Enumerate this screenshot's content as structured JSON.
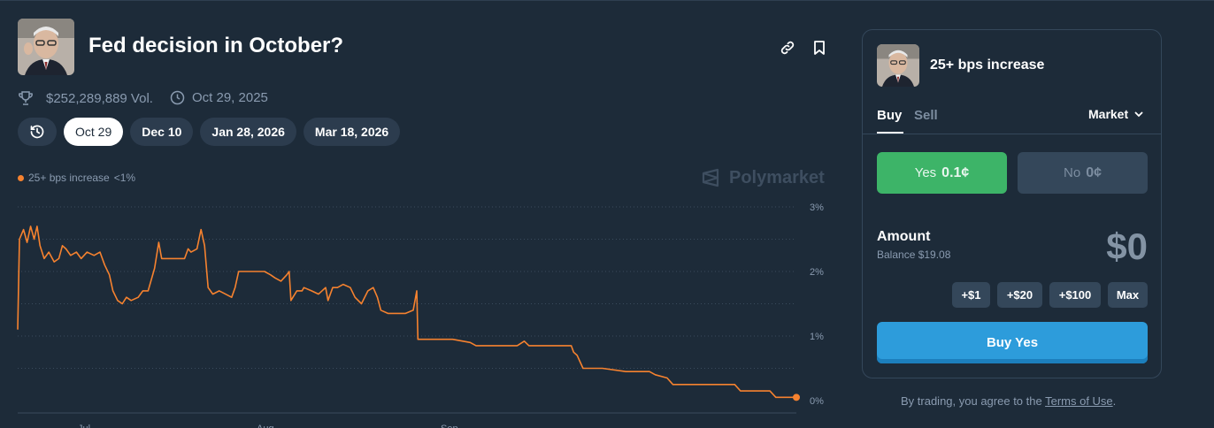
{
  "market": {
    "title": "Fed decision in October?",
    "volume": "$252,289,889 Vol.",
    "date": "Oct 29, 2025",
    "avatar_icon": "powell-portrait",
    "date_tabs": [
      "Oct 29",
      "Dec 10",
      "Jan 28, 2026",
      "Mar 18, 2026"
    ],
    "active_tab": "Oct 29",
    "watermark": "Polymarket"
  },
  "chart_data": {
    "type": "line",
    "legend": [
      {
        "name": "25+ bps increase",
        "value": "<1%",
        "color": "#f6822f"
      }
    ],
    "ylim": [
      0,
      3
    ],
    "y_ticks": [
      "3%",
      "2%",
      "1%",
      "0%"
    ],
    "x_ticks": [
      "Jul",
      "Aug",
      "Sep"
    ],
    "grid": true,
    "series": [
      {
        "name": "25+ bps increase",
        "color": "#f6822f",
        "points": [
          [
            0,
            1.1
          ],
          [
            0.3,
            2.5
          ],
          [
            1,
            2.65
          ],
          [
            1.6,
            2.45
          ],
          [
            2.2,
            2.7
          ],
          [
            2.8,
            2.5
          ],
          [
            3.3,
            2.7
          ],
          [
            3.8,
            2.4
          ],
          [
            4.5,
            2.2
          ],
          [
            5.3,
            2.3
          ],
          [
            6.2,
            2.15
          ],
          [
            7,
            2.2
          ],
          [
            7.6,
            2.4
          ],
          [
            8.2,
            2.35
          ],
          [
            9,
            2.25
          ],
          [
            10,
            2.3
          ],
          [
            10.8,
            2.2
          ],
          [
            11.8,
            2.3
          ],
          [
            13,
            2.25
          ],
          [
            14,
            2.3
          ],
          [
            14.8,
            2.1
          ],
          [
            15.6,
            1.95
          ],
          [
            16.2,
            1.7
          ],
          [
            17,
            1.55
          ],
          [
            17.8,
            1.5
          ],
          [
            18.5,
            1.6
          ],
          [
            19.3,
            1.55
          ],
          [
            20.5,
            1.6
          ],
          [
            21.3,
            1.7
          ],
          [
            22.2,
            1.7
          ],
          [
            23.3,
            2.05
          ],
          [
            24,
            2.45
          ],
          [
            24.5,
            2.2
          ],
          [
            26.2,
            2.2
          ],
          [
            28.4,
            2.2
          ],
          [
            29,
            2.35
          ],
          [
            29.5,
            2.3
          ],
          [
            30.5,
            2.35
          ],
          [
            31.2,
            2.65
          ],
          [
            31.8,
            2.4
          ],
          [
            32.4,
            1.75
          ],
          [
            33.2,
            1.65
          ],
          [
            34.3,
            1.7
          ],
          [
            36.4,
            1.6
          ],
          [
            37,
            1.75
          ],
          [
            37.6,
            2.0
          ],
          [
            42,
            2.0
          ],
          [
            43,
            1.95
          ],
          [
            43.8,
            1.9
          ],
          [
            44.8,
            1.85
          ],
          [
            45.8,
            1.95
          ],
          [
            46.2,
            2.0
          ],
          [
            46.5,
            1.55
          ],
          [
            47.5,
            1.7
          ],
          [
            48.4,
            1.7
          ],
          [
            48.7,
            1.75
          ],
          [
            50,
            1.7
          ],
          [
            51.2,
            1.65
          ],
          [
            52.4,
            1.75
          ],
          [
            52.8,
            1.55
          ],
          [
            53.6,
            1.75
          ],
          [
            54.4,
            1.75
          ],
          [
            55.4,
            1.8
          ],
          [
            56.6,
            1.75
          ],
          [
            57.4,
            1.6
          ],
          [
            58.5,
            1.5
          ],
          [
            59.6,
            1.7
          ],
          [
            60.5,
            1.75
          ],
          [
            61.2,
            1.6
          ],
          [
            61.8,
            1.4
          ],
          [
            63,
            1.35
          ],
          [
            66,
            1.35
          ],
          [
            67.3,
            1.4
          ],
          [
            67.9,
            1.7
          ],
          [
            68.1,
            0.95
          ],
          [
            74,
            0.95
          ],
          [
            77,
            0.9
          ],
          [
            78,
            0.85
          ],
          [
            85,
            0.85
          ],
          [
            86.2,
            0.92
          ],
          [
            87,
            0.85
          ],
          [
            94.2,
            0.85
          ],
          [
            94.6,
            0.75
          ],
          [
            95.2,
            0.7
          ],
          [
            96.2,
            0.5
          ],
          [
            99.5,
            0.5
          ],
          [
            103.5,
            0.45
          ],
          [
            107.5,
            0.45
          ],
          [
            108.5,
            0.4
          ],
          [
            110.5,
            0.35
          ],
          [
            111.5,
            0.25
          ],
          [
            122,
            0.25
          ],
          [
            123,
            0.15
          ],
          [
            128,
            0.15
          ],
          [
            129,
            0.05
          ],
          [
            132.5,
            0.05
          ]
        ]
      }
    ]
  },
  "trade_panel": {
    "outcome_title": "25+ bps increase",
    "tabs": {
      "buy": "Buy",
      "sell": "Sell"
    },
    "order_type": "Market",
    "yes_label": "Yes",
    "yes_price": "0.1¢",
    "no_label": "No",
    "no_price": "0¢",
    "amount_label": "Amount",
    "balance": "Balance $19.08",
    "amount_value": "$0",
    "quick_amounts": [
      "+$1",
      "+$20",
      "+$100",
      "Max"
    ],
    "buy_button": "Buy Yes",
    "terms_prefix": "By trading, you agree to the ",
    "terms_link": "Terms of Use",
    "terms_suffix": "."
  }
}
